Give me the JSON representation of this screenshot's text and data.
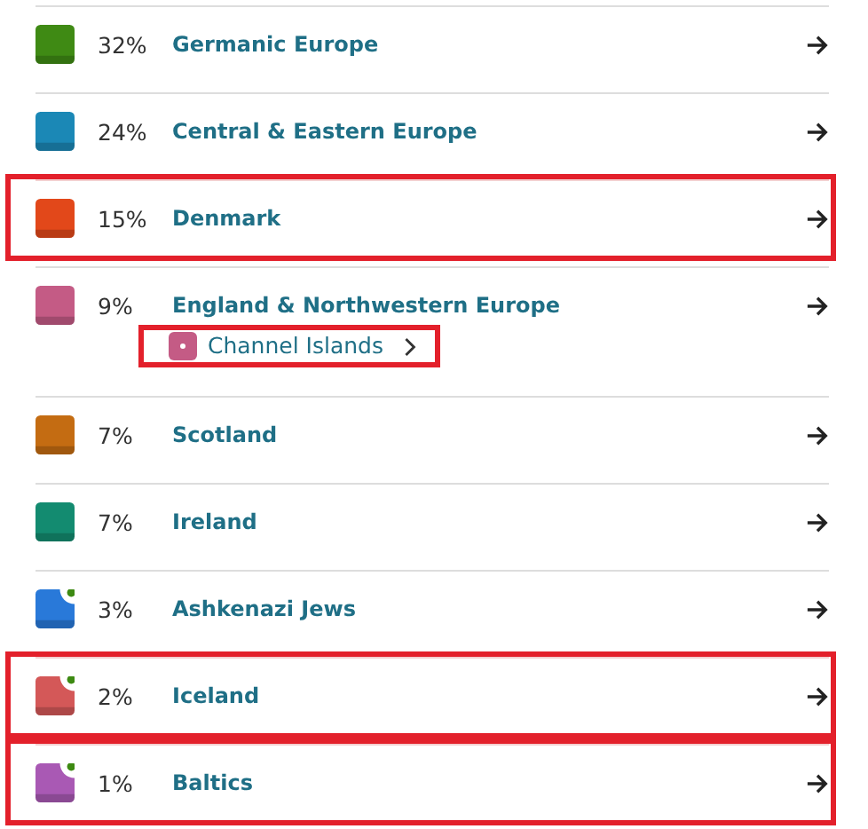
{
  "regions": [
    {
      "percent": "32%",
      "name": "Germanic Europe",
      "color": "#3f8a14",
      "new": false,
      "highlighted": false
    },
    {
      "percent": "24%",
      "name": "Central & Eastern Europe",
      "color": "#1b88b6",
      "new": false,
      "highlighted": false
    },
    {
      "percent": "15%",
      "name": "Denmark",
      "color": "#e2481a",
      "new": false,
      "highlighted": true
    },
    {
      "percent": "9%",
      "name": "England & Northwestern Europe",
      "color": "#c45b85",
      "new": false,
      "highlighted": false,
      "subregions": [
        {
          "name": "Channel Islands",
          "color": "#c45b85",
          "highlighted": true
        }
      ]
    },
    {
      "percent": "7%",
      "name": "Scotland",
      "color": "#c46c12",
      "new": false,
      "highlighted": false
    },
    {
      "percent": "7%",
      "name": "Ireland",
      "color": "#138b70",
      "new": false,
      "highlighted": false
    },
    {
      "percent": "3%",
      "name": "Ashkenazi Jews",
      "color": "#2979d9",
      "new": true,
      "highlighted": false
    },
    {
      "percent": "2%",
      "name": "Iceland",
      "color": "#d45858",
      "new": true,
      "highlighted": true
    },
    {
      "percent": "1%",
      "name": "Baltics",
      "color": "#a959b4",
      "new": true,
      "highlighted": true
    }
  ]
}
